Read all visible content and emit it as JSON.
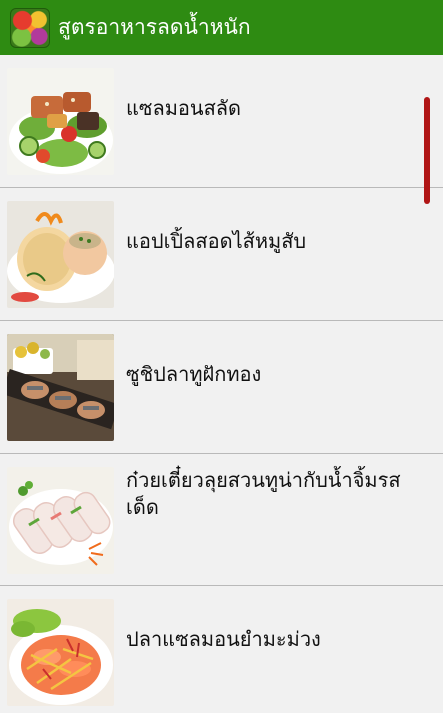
{
  "app_bar": {
    "title": "สูตรอาหารลดน้ำหนัก",
    "icon": "vegetables-app-icon",
    "color": "#2e8b12"
  },
  "recipes": [
    {
      "name": "แซลมอนสลัด",
      "thumbnail": "salmon-salad-image"
    },
    {
      "name": "แอปเปิ้ลสอดไส้หมูสับ",
      "thumbnail": "stuffed-apple-image"
    },
    {
      "name": "ซูชิปลาทูฝักทอง",
      "thumbnail": "mackerel-pumpkin-sushi-image"
    },
    {
      "name": "ก๋วยเตี๋ยวลุยสวนทูน่ากับน้ำจิ้มรสเด็ด",
      "thumbnail": "tuna-fresh-rolls-image"
    },
    {
      "name": "ปลาแซลมอนยำมะม่วง",
      "thumbnail": "salmon-mango-salad-image"
    }
  ],
  "scrollbar_color": "#b01515"
}
